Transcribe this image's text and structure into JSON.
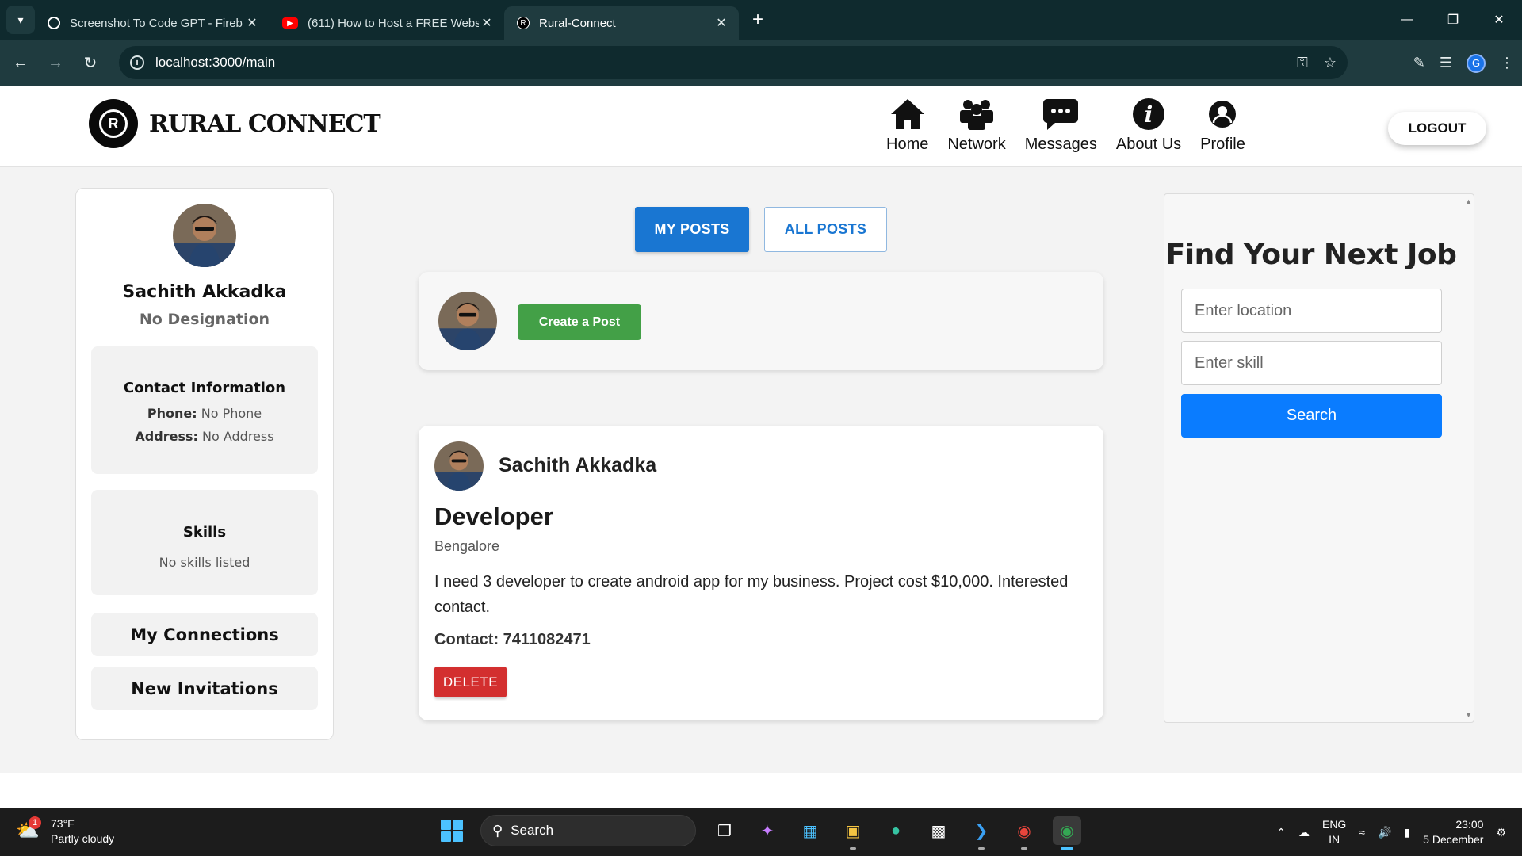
{
  "browser": {
    "tabs": [
      {
        "title": "Screenshot To Code GPT - Fireb",
        "icon": "openai-icon",
        "active": false
      },
      {
        "title": "(611) How to Host a FREE Webs",
        "icon": "youtube-icon",
        "active": false
      },
      {
        "title": "Rural-Connect",
        "icon": "rural-connect-icon",
        "active": true
      }
    ],
    "url": "localhost:3000/main",
    "profile_initial": "G"
  },
  "header": {
    "brand_name": "RURAL CONNECT",
    "brand_logo_letter": "R",
    "nav": [
      {
        "label": "Home",
        "icon": "home-icon"
      },
      {
        "label": "Network",
        "icon": "network-icon"
      },
      {
        "label": "Messages",
        "icon": "messages-icon"
      },
      {
        "label": "About Us",
        "icon": "info-icon"
      },
      {
        "label": "Profile",
        "icon": "profile-icon"
      }
    ],
    "logout_label": "LOGOUT"
  },
  "profile": {
    "name": "Sachith Akkadka",
    "designation": "No Designation",
    "contact_heading": "Contact Information",
    "phone_label": "Phone:",
    "phone_value": "No Phone",
    "address_label": "Address:",
    "address_value": "No Address",
    "skills_heading": "Skills",
    "skills_value": "No skills listed",
    "connections_label": "My Connections",
    "invitations_label": "New Invitations"
  },
  "feed": {
    "tabs": [
      {
        "label": "MY POSTS",
        "active": true
      },
      {
        "label": "ALL POSTS",
        "active": false
      }
    ],
    "create_post_label": "Create a Post",
    "post": {
      "author": "Sachith Akkadka",
      "title": "Developer",
      "location": "Bengalore",
      "body": "I need 3 developer to create android app for my business. Project cost $10,000. Interested contact.",
      "contact_label": "Contact:",
      "contact_value": "7411082471",
      "delete_label": "DELETE"
    }
  },
  "jobs": {
    "title": "Find Your Next Job",
    "location_placeholder": "Enter location",
    "skill_placeholder": "Enter skill",
    "search_label": "Search"
  },
  "taskbar": {
    "weather_temp": "73°F",
    "weather_desc": "Partly cloudy",
    "weather_badge": "1",
    "search_label": "Search",
    "lang_top": "ENG",
    "lang_bottom": "IN",
    "time": "23:00",
    "date": "5 December"
  },
  "colors": {
    "primary_blue": "#1976d2",
    "create_green": "#43a047",
    "delete_red": "#d32f2f",
    "search_blue": "#0a7cff"
  }
}
